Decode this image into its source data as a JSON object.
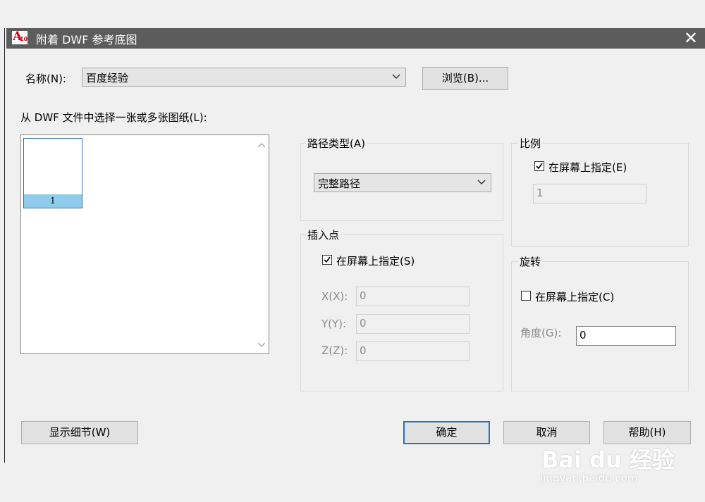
{
  "window": {
    "title": "附着 DWF 参考底图",
    "app_icon_text": "A",
    "app_icon_version": "10"
  },
  "name_row": {
    "label": "名称(N):",
    "selected": "百度经验",
    "browse_label": "浏览(B)..."
  },
  "sheet_list": {
    "label": "从 DWF 文件中选择一张或多张图纸(L):",
    "items": [
      {
        "caption": "1"
      }
    ]
  },
  "path_type": {
    "title": "路径类型(A)",
    "selected": "完整路径"
  },
  "insertion_point": {
    "title": "插入点",
    "checkbox_label": "在屏幕上指定(S)",
    "checked": true,
    "x_label": "X(X):",
    "x_value": "0",
    "y_label": "Y(Y):",
    "y_value": "0",
    "z_label": "Z(Z):",
    "z_value": "0"
  },
  "scale": {
    "title": "比例",
    "checkbox_label": "在屏幕上指定(E)",
    "checked": true,
    "value": "1"
  },
  "rotation": {
    "title": "旋转",
    "checkbox_label": "在屏幕上指定(C)",
    "checked": false,
    "angle_label": "角度(G):",
    "angle_value": "0"
  },
  "buttons": {
    "details": "显示细节(W)",
    "ok": "确定",
    "cancel": "取消",
    "help": "帮助(H)"
  },
  "watermark": {
    "brand": "Bai du 经验",
    "url": "jingyan.baidu.com"
  },
  "colors": {
    "titlebar": "#5c5c5c",
    "accent": "#2672c0",
    "selection": "#8fcbea"
  }
}
